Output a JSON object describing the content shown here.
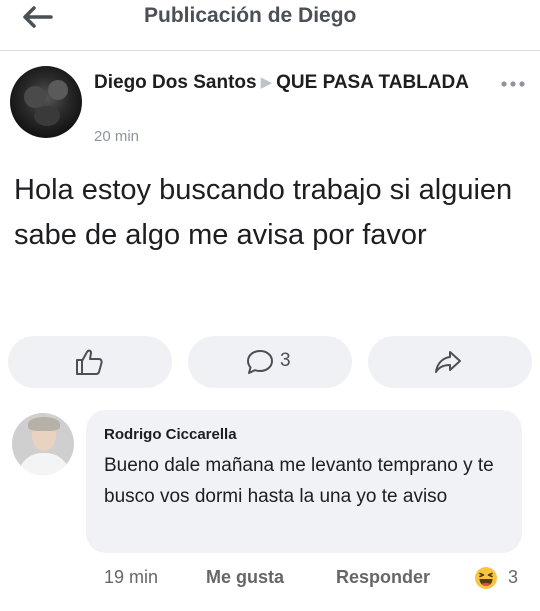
{
  "header": {
    "title": "Publicación de Diego",
    "back_icon": "arrow-left-icon"
  },
  "post": {
    "author": "Diego Dos Santos",
    "target": "QUE PASA TABLADA",
    "time": "20 min",
    "text": "Hola estoy buscando trabajo si alguien sabe de algo me avisa por favor",
    "comment_count": "3",
    "actions": {
      "like_icon": "thumbs-up-icon",
      "comment_icon": "comment-icon",
      "share_icon": "share-icon"
    }
  },
  "comment": {
    "author": "Rodrigo Ciccarella",
    "text": "Bueno dale mañana me levanto temprano y te busco vos dormi hasta la una yo te aviso",
    "time": "19 min",
    "like_label": "Me gusta",
    "reply_label": "Responder",
    "reaction_icon": "haha-emoji-icon",
    "reaction_count": "3"
  },
  "colors": {
    "secondary_text": "#65676b",
    "bubble": "#f0f2f5",
    "button_bg": "#eff1f4"
  }
}
